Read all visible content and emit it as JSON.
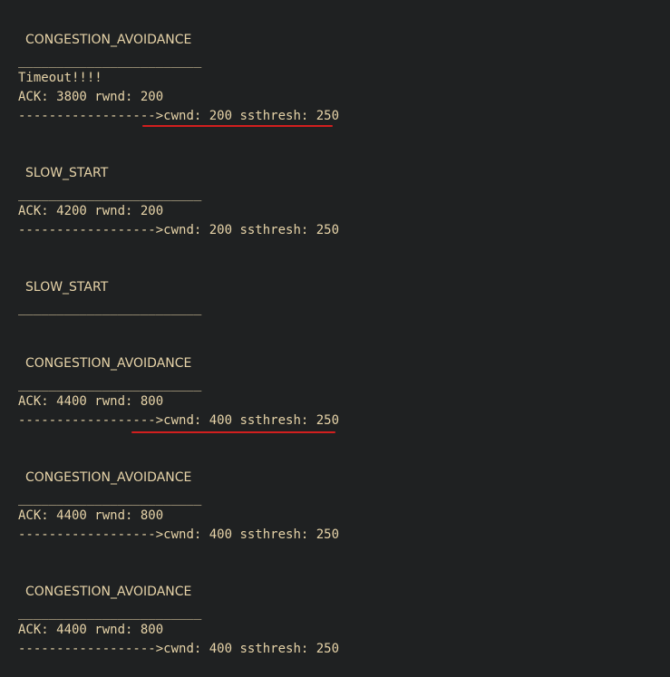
{
  "log": {
    "separator": "________________________",
    "arrow": "------------------>",
    "blocks": [
      {
        "state": "CONGESTION_AVOIDANCE",
        "message": "Timeout!!!!",
        "ack": "ACK: 3800 rwnd: 200",
        "result": "cwnd: 200 ssthresh: 250",
        "underlined": true
      },
      {
        "state": "SLOW_START",
        "ack": "ACK: 4200 rwnd: 200",
        "result": "cwnd: 200 ssthresh: 250",
        "underlined": false
      },
      {
        "state": "SLOW_START"
      },
      {
        "state": "CONGESTION_AVOIDANCE",
        "ack": "ACK: 4400 rwnd: 800",
        "result": "cwnd: 400 ssthresh: 250",
        "underlined": true
      },
      {
        "state": "CONGESTION_AVOIDANCE",
        "ack": "ACK: 4400 rwnd: 800",
        "result": "cwnd: 400 ssthresh: 250",
        "underlined": false
      },
      {
        "state": "CONGESTION_AVOIDANCE",
        "ack": "ACK: 4400 rwnd: 800",
        "result": "cwnd: 400 ssthresh: 250",
        "underlined": false
      }
    ]
  },
  "colors": {
    "background": "#1f2122",
    "text": "#e6d3a8",
    "annotation": "#d21f1f"
  }
}
